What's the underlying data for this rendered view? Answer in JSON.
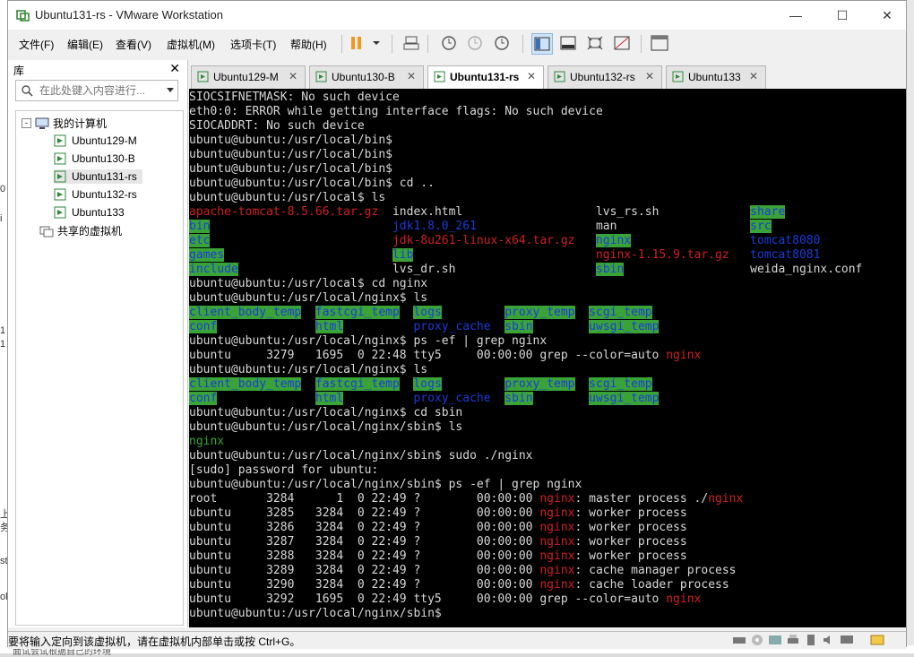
{
  "window": {
    "title": "Ubuntu131-rs - VMware Workstation"
  },
  "menu": [
    "文件(F)",
    "编辑(E)",
    "查看(V)",
    "虚拟机(M)",
    "选项卡(T)",
    "帮助(H)"
  ],
  "library": {
    "header": "库",
    "search_placeholder": "在此处键入内容进行...",
    "root": "我的计算机",
    "vms": [
      "Ubuntu129-M",
      "Ubuntu130-B",
      "Ubuntu131-rs",
      "Ubuntu132-rs",
      "Ubuntu133"
    ],
    "shared": "共享的虚拟机",
    "selected_index": 2
  },
  "tabs": [
    {
      "label": "Ubuntu129-M",
      "active": false
    },
    {
      "label": "Ubuntu130-B",
      "active": false
    },
    {
      "label": "Ubuntu131-rs",
      "active": true
    },
    {
      "label": "Ubuntu132-rs",
      "active": false
    },
    {
      "label": "Ubuntu133",
      "active": false
    }
  ],
  "terminal_lines": [
    [
      [
        "SIOCSIFNETMASK: No such device",
        ""
      ]
    ],
    [
      [
        "eth0:0: ERROR while getting interface flags: No such device",
        ""
      ]
    ],
    [
      [
        "SIOCADDRT: No such device",
        ""
      ]
    ],
    [
      [
        "ubuntu@ubuntu:/usr/local/bin$",
        ""
      ]
    ],
    [
      [
        "ubuntu@ubuntu:/usr/local/bin$",
        ""
      ]
    ],
    [
      [
        "ubuntu@ubuntu:/usr/local/bin$",
        ""
      ]
    ],
    [
      [
        "ubuntu@ubuntu:/usr/local/bin$ cd ..",
        ""
      ]
    ],
    [
      [
        "ubuntu@ubuntu:/usr/local$ ls",
        ""
      ]
    ],
    [
      [
        "apache-tomcat-8.5.66.tar.gz",
        "r"
      ],
      [
        "  index.html                   lvs_rs.sh             ",
        ""
      ],
      [
        "share",
        "g"
      ]
    ],
    [
      [
        "bin",
        "g"
      ],
      [
        "                          ",
        ""
      ],
      [
        "jdk1.8.0_261",
        "b"
      ],
      [
        "                 man                   ",
        ""
      ],
      [
        "src",
        "g"
      ]
    ],
    [
      [
        "etc",
        "g"
      ],
      [
        "                          ",
        ""
      ],
      [
        "jdk-8u261-linux-x64.tar.gz",
        "r"
      ],
      [
        "   ",
        ""
      ],
      [
        "nginx",
        "g"
      ],
      [
        "                 ",
        ""
      ],
      [
        "tomcat8080",
        "b"
      ]
    ],
    [
      [
        "games",
        "g"
      ],
      [
        "                        ",
        ""
      ],
      [
        "lib",
        "g"
      ],
      [
        "                          ",
        ""
      ],
      [
        "nginx-1.15.9.tar.gz",
        "r"
      ],
      [
        "   ",
        ""
      ],
      [
        "tomcat8081",
        "b"
      ]
    ],
    [
      [
        "include",
        "g"
      ],
      [
        "                      lvs_dr.sh                    ",
        ""
      ],
      [
        "sbin",
        "g"
      ],
      [
        "                  weida_nginx.conf",
        ""
      ]
    ],
    [
      [
        "ubuntu@ubuntu:/usr/local$ cd nginx",
        ""
      ]
    ],
    [
      [
        "ubuntu@ubuntu:/usr/local/nginx$ ls",
        ""
      ]
    ],
    [
      [
        "client_body_temp",
        "g"
      ],
      [
        "  ",
        ""
      ],
      [
        "fastcgi_temp",
        "g"
      ],
      [
        "  ",
        ""
      ],
      [
        "logs",
        "g"
      ],
      [
        "         ",
        ""
      ],
      [
        "proxy_temp",
        "g"
      ],
      [
        "  ",
        ""
      ],
      [
        "scgi_temp",
        "g"
      ]
    ],
    [
      [
        "conf",
        "g"
      ],
      [
        "              ",
        ""
      ],
      [
        "html",
        "g"
      ],
      [
        "          ",
        ""
      ],
      [
        "proxy_cache",
        "b"
      ],
      [
        "  ",
        ""
      ],
      [
        "sbin",
        "g"
      ],
      [
        "        ",
        ""
      ],
      [
        "uwsgi_temp",
        "g"
      ]
    ],
    [
      [
        "ubuntu@ubuntu:/usr/local/nginx$ ps -ef | grep nginx",
        ""
      ]
    ],
    [
      [
        "ubuntu     3279   1695  0 22:48 tty5     00:00:00 grep --color=auto ",
        ""
      ],
      [
        "nginx",
        "r"
      ]
    ],
    [
      [
        "ubuntu@ubuntu:/usr/local/nginx$ ls",
        ""
      ]
    ],
    [
      [
        "client_body_temp",
        "g"
      ],
      [
        "  ",
        ""
      ],
      [
        "fastcgi_temp",
        "g"
      ],
      [
        "  ",
        ""
      ],
      [
        "logs",
        "g"
      ],
      [
        "         ",
        ""
      ],
      [
        "proxy_temp",
        "g"
      ],
      [
        "  ",
        ""
      ],
      [
        "scgi_temp",
        "g"
      ]
    ],
    [
      [
        "conf",
        "g"
      ],
      [
        "              ",
        ""
      ],
      [
        "html",
        "g"
      ],
      [
        "          ",
        ""
      ],
      [
        "proxy_cache",
        "b"
      ],
      [
        "  ",
        ""
      ],
      [
        "sbin",
        "g"
      ],
      [
        "        ",
        ""
      ],
      [
        "uwsgi_temp",
        "g"
      ]
    ],
    [
      [
        "ubuntu@ubuntu:/usr/local/nginx$ cd sbin",
        ""
      ]
    ],
    [
      [
        "ubuntu@ubuntu:/usr/local/nginx/sbin$ ls",
        ""
      ]
    ],
    [
      [
        "nginx",
        "gt"
      ]
    ],
    [
      [
        "ubuntu@ubuntu:/usr/local/nginx/sbin$ sudo ./nginx",
        ""
      ]
    ],
    [
      [
        "[sudo] password for ubuntu:",
        ""
      ]
    ],
    [
      [
        "ubuntu@ubuntu:/usr/local/nginx/sbin$ ps -ef | grep nginx",
        ""
      ]
    ],
    [
      [
        "root       3284      1  0 22:49 ?        00:00:00 ",
        ""
      ],
      [
        "nginx",
        "r"
      ],
      [
        ": master process ./",
        ""
      ],
      [
        "nginx",
        "r"
      ]
    ],
    [
      [
        "ubuntu     3285   3284  0 22:49 ?        00:00:00 ",
        ""
      ],
      [
        "nginx",
        "r"
      ],
      [
        ": worker process",
        ""
      ]
    ],
    [
      [
        "ubuntu     3286   3284  0 22:49 ?        00:00:00 ",
        ""
      ],
      [
        "nginx",
        "r"
      ],
      [
        ": worker process",
        ""
      ]
    ],
    [
      [
        "ubuntu     3287   3284  0 22:49 ?        00:00:00 ",
        ""
      ],
      [
        "nginx",
        "r"
      ],
      [
        ": worker process",
        ""
      ]
    ],
    [
      [
        "ubuntu     3288   3284  0 22:49 ?        00:00:00 ",
        ""
      ],
      [
        "nginx",
        "r"
      ],
      [
        ": worker process",
        ""
      ]
    ],
    [
      [
        "ubuntu     3289   3284  0 22:49 ?        00:00:00 ",
        ""
      ],
      [
        "nginx",
        "r"
      ],
      [
        ": cache manager process",
        ""
      ]
    ],
    [
      [
        "ubuntu     3290   3284  0 22:49 ?        00:00:00 ",
        ""
      ],
      [
        "nginx",
        "r"
      ],
      [
        ": cache loader process",
        ""
      ]
    ],
    [
      [
        "ubuntu     3292   1695  0 22:49 tty5     00:00:00 grep --color=auto ",
        ""
      ],
      [
        "nginx",
        "r"
      ]
    ],
    [
      [
        "ubuntu@ubuntu:/usr/local/nginx/sbin$",
        ""
      ]
    ]
  ],
  "status_text": "要将输入定向到该虚拟机，请在虚拟机内部单击或按 Ctrl+G。",
  "background_text": "面试会试根据自己的环境",
  "colors": {
    "terminal_bg": "#000000",
    "terminal_fg": "#d8d8d8",
    "dir_bg": "#3aa338",
    "archive": "#d21f1f",
    "link": "#1a3bd8"
  }
}
